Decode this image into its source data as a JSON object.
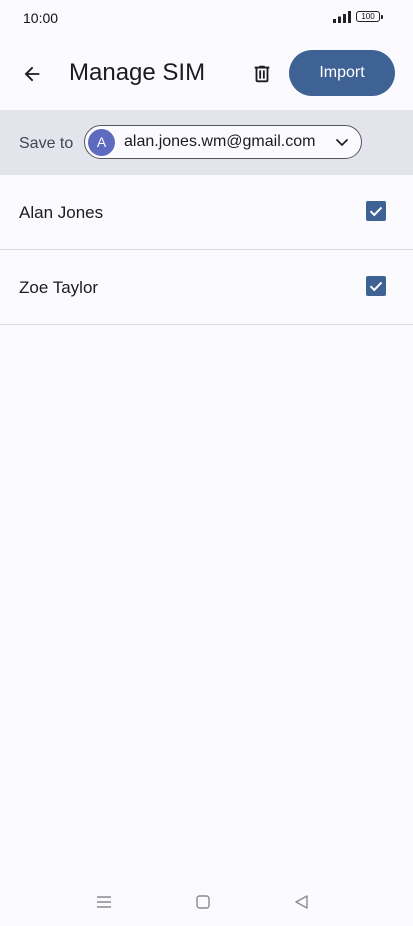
{
  "status_bar": {
    "time": "10:00",
    "battery": "100",
    "icons": [
      "signal-icon",
      "battery-icon"
    ]
  },
  "app_bar": {
    "title": "Manage SIM",
    "back_icon": "arrow-left-icon",
    "delete_icon": "trash-icon",
    "import_label": "Import"
  },
  "save_to": {
    "label": "Save to",
    "avatar_letter": "A",
    "account_email": "alan.jones.wm@gmail.com",
    "dropdown_icon": "chevron-down-icon"
  },
  "contacts": [
    {
      "name": "Alan Jones",
      "checked": true
    },
    {
      "name": "Zoe Taylor",
      "checked": true
    }
  ],
  "nav_bar": {
    "icons": [
      "menu-icon",
      "home-icon",
      "back-triangle-icon"
    ]
  },
  "colors": {
    "accent": "#3f6294",
    "avatar": "#5c6bc0",
    "save_bar_bg": "#e3e4ec",
    "page_bg": "#fbfaff"
  }
}
